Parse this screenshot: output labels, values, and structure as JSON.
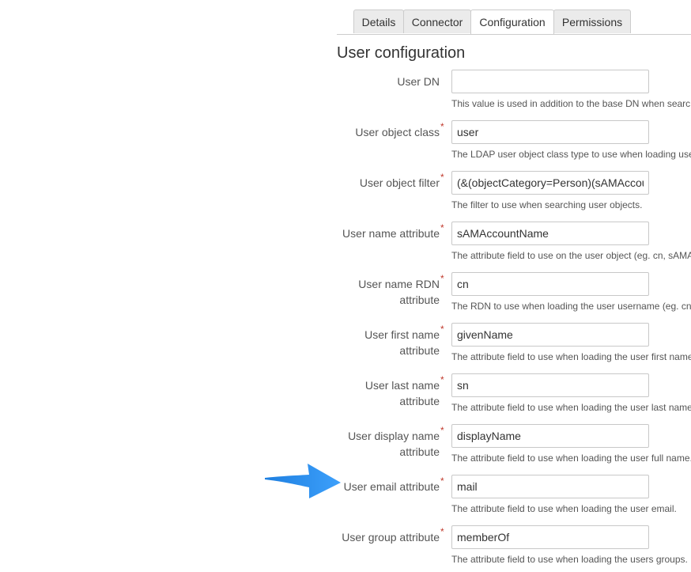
{
  "tabs": [
    {
      "label": "Details",
      "active": false
    },
    {
      "label": "Connector",
      "active": false
    },
    {
      "label": "Configuration",
      "active": true
    },
    {
      "label": "Permissions",
      "active": false
    }
  ],
  "section_title": "User configuration",
  "accent_colors": {
    "arrow": "#2b8fef",
    "required_marker": "#c0392b"
  },
  "fields": [
    {
      "label": "User DN",
      "required": false,
      "value": "",
      "help": "This value is used in addition to the base DN when searc"
    },
    {
      "label": "User object class",
      "required": true,
      "value": "user",
      "help": "The LDAP user object class type to use when loading use"
    },
    {
      "label": "User object filter",
      "required": true,
      "value": "(&(objectCategory=Person)(sAMAccou",
      "help": "The filter to use when searching user objects."
    },
    {
      "label": "User name attribute",
      "required": true,
      "value": "sAMAccountName",
      "help": "The attribute field to use on the user object (eg. cn, sAMA"
    },
    {
      "label": "User name RDN attribute",
      "required": true,
      "value": "cn",
      "help": "The RDN to use when loading the user username (eg. cn"
    },
    {
      "label": "User first name attribute",
      "required": true,
      "value": "givenName",
      "help": "The attribute field to use when loading the user first name"
    },
    {
      "label": "User last name attribute",
      "required": true,
      "value": "sn",
      "help": "The attribute field to use when loading the user last name"
    },
    {
      "label": "User display name attribute",
      "required": true,
      "value": "displayName",
      "help": "The attribute field to use when loading the user full name."
    },
    {
      "label": "User email attribute",
      "required": true,
      "value": "mail",
      "help": "The attribute field to use when loading the user email."
    },
    {
      "label": "User group attribute",
      "required": true,
      "value": "memberOf",
      "help": "The attribute field to use when loading the users groups."
    }
  ]
}
